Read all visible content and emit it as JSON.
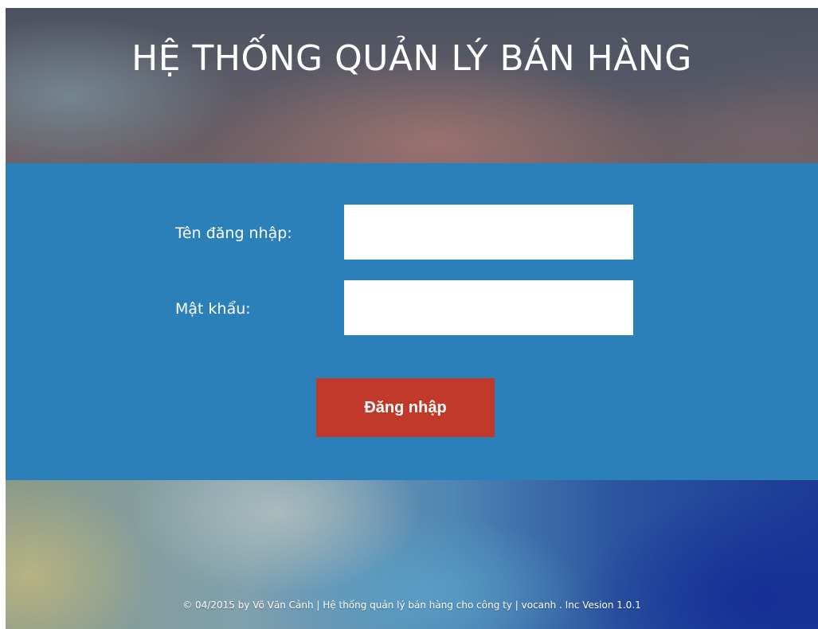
{
  "header": {
    "title": "HỆ THỐNG QUẢN LÝ BÁN HÀNG"
  },
  "login_form": {
    "username_label": "Tên đăng nhập:",
    "username_value": "",
    "password_label": "Mật khẩu:",
    "password_value": "",
    "submit_label": "Đăng nhập"
  },
  "footer": {
    "copyright": "© 04/2015 by Võ Văn Cảnh | Hệ thống quản lý bán hàng cho công ty | vocanh . Inc Vesion 1.0.1"
  },
  "colors": {
    "panel_background": "#2b80b9",
    "button_background": "#c0392b",
    "text": "#ffffff"
  }
}
